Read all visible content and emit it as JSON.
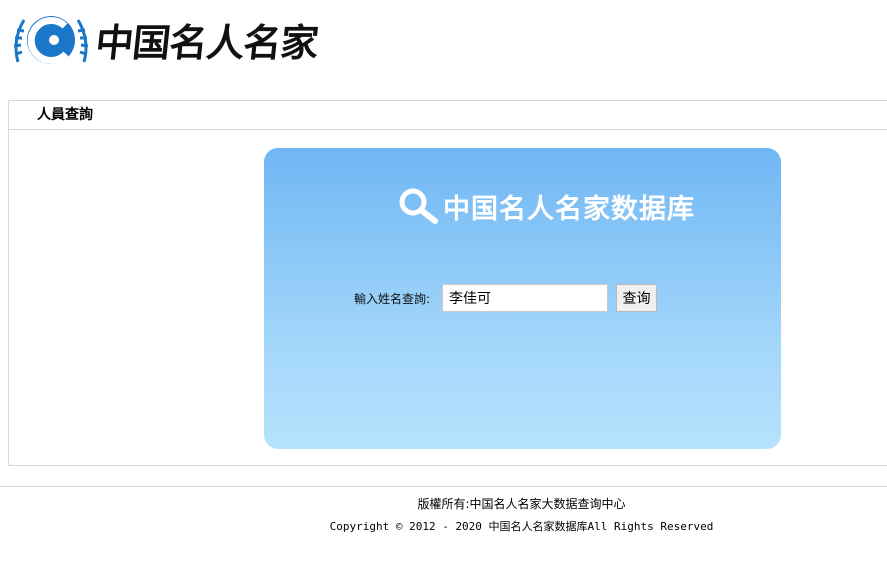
{
  "header": {
    "logo_icon": "chinese-celebrity-emblem-icon",
    "logo_text": "中国名人名家"
  },
  "panel": {
    "title": "人員查詢"
  },
  "search": {
    "icon": "magnifier-icon",
    "title": "中国名人名家数据库",
    "label": "輸入姓名查詢:",
    "input_value": "李佳可",
    "button_label": "查询"
  },
  "footer": {
    "owner": "版權所有:中国名人名家大数据查询中心",
    "copyright": "Copyright © 2012 - 2020 中国名人名家数据库All Rights Reserved"
  },
  "colors": {
    "card_top": "#6fb6f4",
    "card_bottom": "#b6e3fd",
    "logo_blue": "#1b78c8"
  }
}
